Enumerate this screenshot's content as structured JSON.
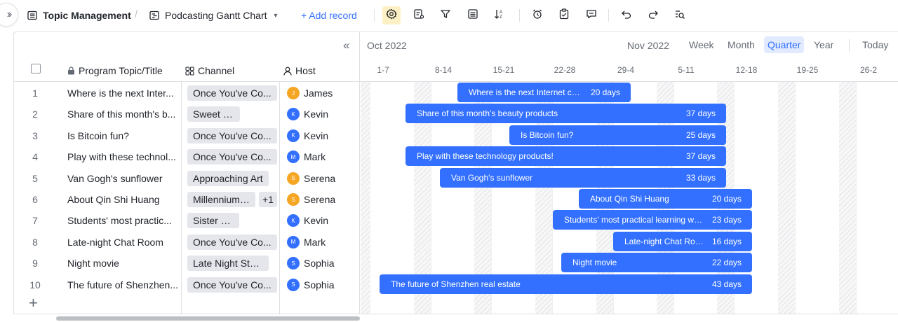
{
  "toolbar": {
    "table_name": "Topic Management",
    "view_name": "Podcasting Gantt Chart",
    "add_record": "+ Add record"
  },
  "columns": {
    "title": "Program Topic/Title",
    "channel": "Channel",
    "host": "Host"
  },
  "gantt": {
    "month_left": "Oct 2022",
    "month_right": "Nov 2022",
    "views": [
      "Week",
      "Month",
      "Quarter",
      "Year"
    ],
    "active_view": "Quarter",
    "today": "Today",
    "weeks": [
      "1-7",
      "8-14",
      "15-21",
      "22-28",
      "29-4",
      "5-11",
      "12-18",
      "19-25",
      "26-2"
    ]
  },
  "colors": {
    "accent": "#3370ff",
    "avatar_blue": "#3370ff",
    "avatar_orange": "#f5a623",
    "avatar_indigo": "#4e6ef2",
    "settings_active_bg": "#fdf0c5"
  },
  "rows": [
    {
      "num": "1",
      "title": "Where is the next Inter...",
      "channel": "Once You've Co...",
      "extra": "",
      "host": "James",
      "host_initial": "J",
      "host_color": "orange",
      "bar_text": "Where is the next Internet cus...",
      "days": "20 days"
    },
    {
      "num": "2",
      "title": "Share of this month's b...",
      "channel": "Sweet FM",
      "extra": "",
      "host": "Kevin",
      "host_initial": "K",
      "host_color": "blue",
      "bar_text": "Share of this month's beauty products",
      "days": "37 days"
    },
    {
      "num": "3",
      "title": "Is Bitcoin fun?",
      "channel": "Once You've Co...",
      "extra": "",
      "host": "Kevin",
      "host_initial": "K",
      "host_color": "blue",
      "bar_text": "Is Bitcoin fun?",
      "days": "25 days"
    },
    {
      "num": "4",
      "title": "Play with these technol...",
      "channel": "Once You've Co...",
      "extra": "",
      "host": "Mark",
      "host_initial": "M",
      "host_color": "blue",
      "bar_text": "Play with these technology products!",
      "days": "37 days"
    },
    {
      "num": "5",
      "title": "Van Gogh's sunflower",
      "channel": "Approaching Art",
      "extra": "",
      "host": "Serena",
      "host_initial": "S",
      "host_color": "orange",
      "bar_text": "Van Gogh's sunflower",
      "days": "33 days"
    },
    {
      "num": "6",
      "title": "About Qin Shi Huang",
      "channel": "Millennium ...",
      "extra": "+1",
      "host": "Serena",
      "host_initial": "S",
      "host_color": "orange",
      "bar_text": "About Qin Shi Huang",
      "days": "20 days"
    },
    {
      "num": "7",
      "title": "Students' most practic...",
      "channel": "Sister FM",
      "extra": "",
      "host": "Kevin",
      "host_initial": "K",
      "host_color": "blue",
      "bar_text": "Students' most practical learning web...",
      "days": "23 days"
    },
    {
      "num": "8",
      "title": "Late-night Chat Room",
      "channel": "Once You've Co...",
      "extra": "",
      "host": "Mark",
      "host_initial": "M",
      "host_color": "blue",
      "bar_text": "Late-night Chat Room",
      "days": "16 days"
    },
    {
      "num": "9",
      "title": "Night movie",
      "channel": "Late Night Story",
      "extra": "",
      "host": "Sophia",
      "host_initial": "S",
      "host_color": "blue",
      "bar_text": "Night movie",
      "days": "22 days"
    },
    {
      "num": "10",
      "title": "The future of Shenzhen...",
      "channel": "Once You've Co...",
      "extra": "",
      "host": "Sophia",
      "host_initial": "S",
      "host_color": "blue",
      "bar_text": "The future of Shenzhen real estate",
      "days": "43 days"
    }
  ]
}
